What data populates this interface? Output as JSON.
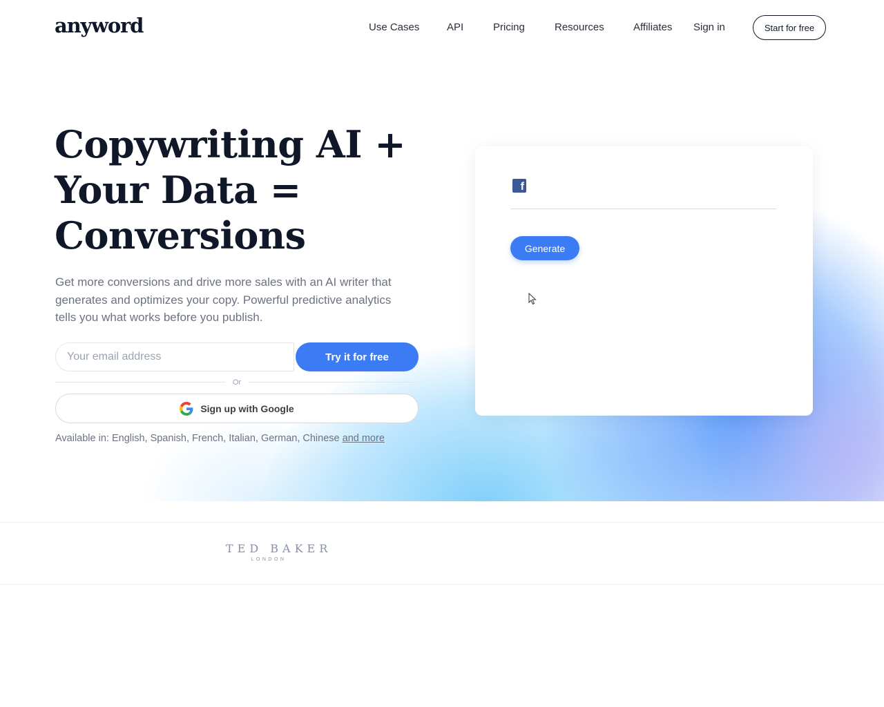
{
  "brand": {
    "logo_text": "anyword"
  },
  "nav": {
    "items": [
      "Use Cases",
      "API",
      "Pricing",
      "Resources",
      "Affiliates",
      "Sign in"
    ],
    "cta_label": "Start for free"
  },
  "hero": {
    "headline_lines": [
      "Copywriting AI +",
      "Your Data =",
      "Conversions"
    ],
    "subtitle": "Get more conversions and drive more sales with an AI writer that generates and optimizes your copy. Powerful predictive analytics tells you what works before you publish.",
    "email_placeholder": "Your email address",
    "try_label": "Try it for free",
    "or_label": "Or",
    "google_label": "Sign up with Google",
    "available_prefix": "Available in: English, Spanish, French, Italian, German, Chinese",
    "available_link": "and more"
  },
  "demo_card": {
    "platform_icon": "facebook-icon",
    "generate_label": "Generate"
  },
  "logos": {
    "ted_baker_main": "TED BAKER",
    "ted_baker_sub": "LONDON"
  },
  "colors": {
    "primary": "#3b7cf5",
    "text_dark": "#0f1729",
    "text_muted": "#6b7280",
    "facebook": "#3b5998"
  }
}
